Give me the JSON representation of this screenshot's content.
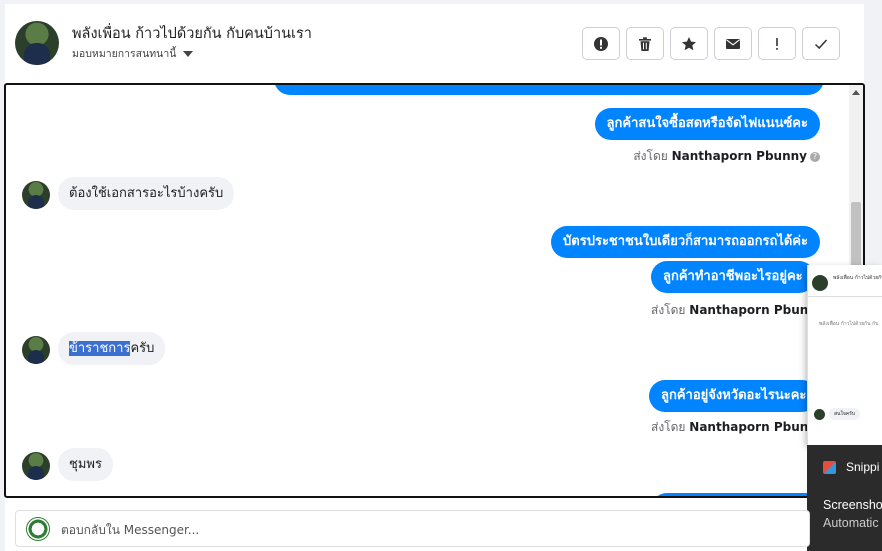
{
  "header": {
    "title": "พลังเพื่อน ก้าวไปด้วยกัน กับคนบ้านเรา",
    "subtitle": "มอบหมายการสนทนานี้"
  },
  "actions": [
    {
      "name": "mark-spam-button",
      "icon": "exclamation-circle-icon"
    },
    {
      "name": "delete-button",
      "icon": "trash-icon"
    },
    {
      "name": "star-button",
      "icon": "star-icon"
    },
    {
      "name": "mark-unread-button",
      "icon": "envelope-icon"
    },
    {
      "name": "flag-button",
      "icon": "exclamation-icon"
    },
    {
      "name": "mark-done-button",
      "icon": "check-icon"
    }
  ],
  "messages": {
    "out1": "ลูกค้าสนใจซื้อสดหรือจัดไฟแนนซ์คะ",
    "sent1_prefix": "ส่งโดย",
    "sent1_name": "Nanthaporn Pbunny",
    "in1": "ต้องใช้เอกสารอะไรบ้างครับ",
    "out2": "บัตรประชาชนใบเดียวก็สามารถออกรถได้ค่ะ",
    "out3": "ลูกค้าทำอาชีพอะไรอยู่คะ",
    "sent2_prefix": "ส่งโดย",
    "sent2_name": "Nanthaporn Pbunny",
    "in2_highlight": "ข้าราชการ",
    "in2_rest": "ครับ",
    "out4": "ลูกค้าอยู่จังหวัดอะไรนะคะ",
    "sent3_prefix": "ส่งโดย",
    "sent3_name": "Nanthaporn Pbunny",
    "in3": "ชุมพร"
  },
  "popup": {
    "title": "พลังเพื่อน ก้าวไปด้วยกัน",
    "line": "พลังเพื่อน ก้าวไปด้วยกัน กับ",
    "bubble": "สนใจครับ"
  },
  "toast": {
    "app": "Snippi",
    "line1": "Screensho",
    "line2": "Automatic"
  },
  "reply": {
    "placeholder": "ตอบกลับใน Messenger..."
  },
  "colors": {
    "outgoing_bubble": "#0084ff",
    "incoming_bubble": "#f0f2f5",
    "highlight": "#3b6fd0"
  }
}
